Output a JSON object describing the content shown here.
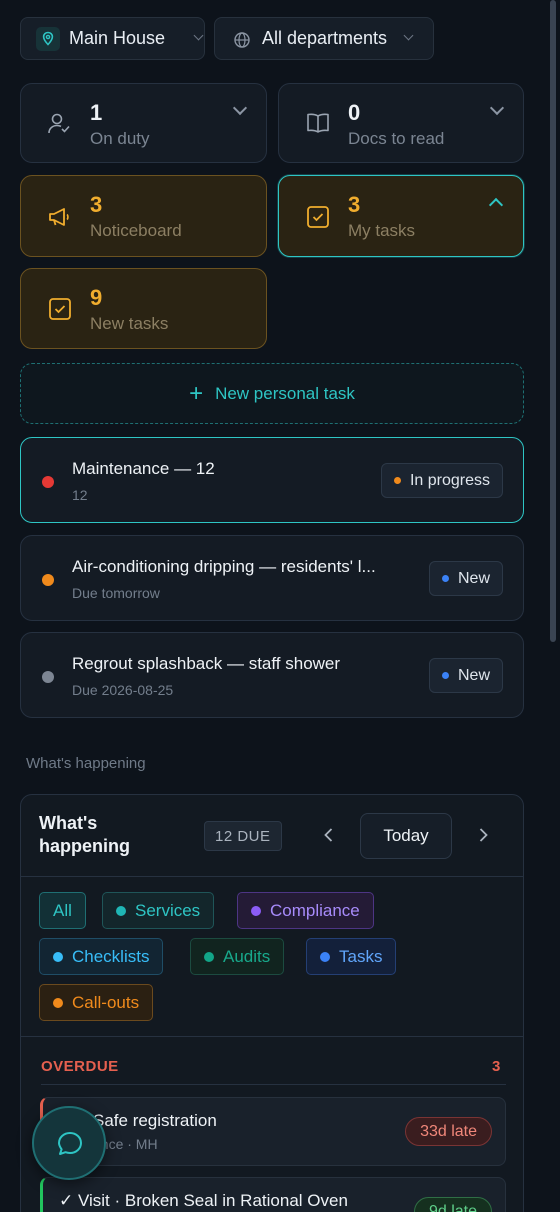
{
  "filters": {
    "location": "Main House",
    "department": "All departments"
  },
  "stats": {
    "on_duty": {
      "count": "1",
      "label": "On duty"
    },
    "docs": {
      "count": "0",
      "label": "Docs to read"
    },
    "noticeboard": {
      "count": "3",
      "label": "Noticeboard"
    },
    "my_tasks": {
      "count": "3",
      "label": "My tasks"
    },
    "new_tasks": {
      "count": "9",
      "label": "New tasks"
    }
  },
  "new_task_button": "New personal task",
  "tasks": [
    {
      "title": "Maintenance — 12",
      "subtitle": "12",
      "status": "In progress",
      "dot_color": "#e53935",
      "status_color": "#f08a1c"
    },
    {
      "title": "Air-conditioning dripping — residents' l...",
      "subtitle": "Due tomorrow",
      "status": "New",
      "dot_color": "#f08a1c",
      "status_color": "#3b82f6"
    },
    {
      "title": "Regrout splashback — staff shower",
      "subtitle": "Due 2026-08-25",
      "status": "New",
      "dot_color": "#7d8693",
      "status_color": "#3b82f6"
    }
  ],
  "section_label": "What's happening",
  "happening": {
    "title_line1": "What's",
    "title_line2": "happening",
    "due_badge": "12 DUE",
    "today_button": "Today",
    "chips": [
      {
        "label": "All"
      },
      {
        "label": "Services",
        "color": "#1fb6b5"
      },
      {
        "label": "Compliance",
        "color": "#8b5cf6"
      },
      {
        "label": "Checklists",
        "color": "#38bdf8"
      },
      {
        "label": "Audits",
        "color": "#12a588"
      },
      {
        "label": "Tasks",
        "color": "#3b82f6"
      },
      {
        "label": "Call-outs",
        "color": "#f08a1c"
      }
    ],
    "overdue_label": "OVERDUE",
    "overdue_count": "3",
    "items": [
      {
        "title": "Safe registration",
        "subtitle": "ance · MH",
        "late": "33d late"
      },
      {
        "title": "✓ Visit · Broken Seal in Rational Oven",
        "late": "9d late"
      }
    ]
  }
}
